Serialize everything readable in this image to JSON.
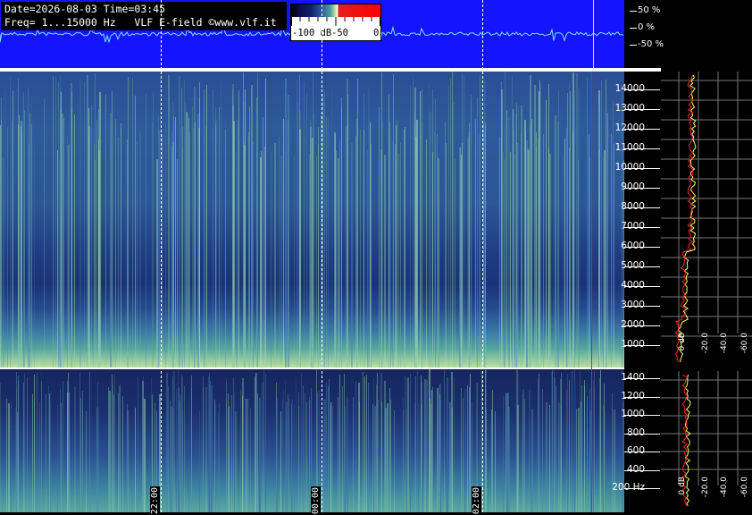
{
  "header": {
    "line1": "Date=2026-08-03 Time=03:45",
    "line2": "Freq= 1...15000 Hz   VLF E-field ©www.vlf.it"
  },
  "colorbar": {
    "labels": [
      "-100 dB",
      "-50",
      "0"
    ],
    "colors": {
      "low": "#000000",
      "mid": "#4aa0a0",
      "high": "#ff0000"
    }
  },
  "amplitude_scale": [
    "50 %",
    "0 %",
    "-50 %"
  ],
  "upper_freq_labels": [
    "14000",
    "13000",
    "12000",
    "11000",
    "10000",
    "9000",
    "8000",
    "7000",
    "6000",
    "5000",
    "4000",
    "3000",
    "2000",
    "1000"
  ],
  "lower_freq_labels": [
    "1400",
    "1200",
    "1000",
    "800",
    "600",
    "400",
    "200 Hz"
  ],
  "time_labels": [
    "22:00",
    "00:00",
    "02:00"
  ],
  "db_labels_upper": [
    "0 dB",
    "-20.0",
    "-40.0",
    "-60.0",
    "-20.0 dB"
  ],
  "db_labels_lower": [
    "0 dB",
    "-20.0",
    "-40.0",
    "-60.0",
    "-20.0 dB"
  ],
  "colors": {
    "background": "#000000",
    "waveform_bg": "#1414ff",
    "cursor": "#e02020",
    "profile_avg": "#ffff00",
    "profile_peak": "#ff2020"
  }
}
